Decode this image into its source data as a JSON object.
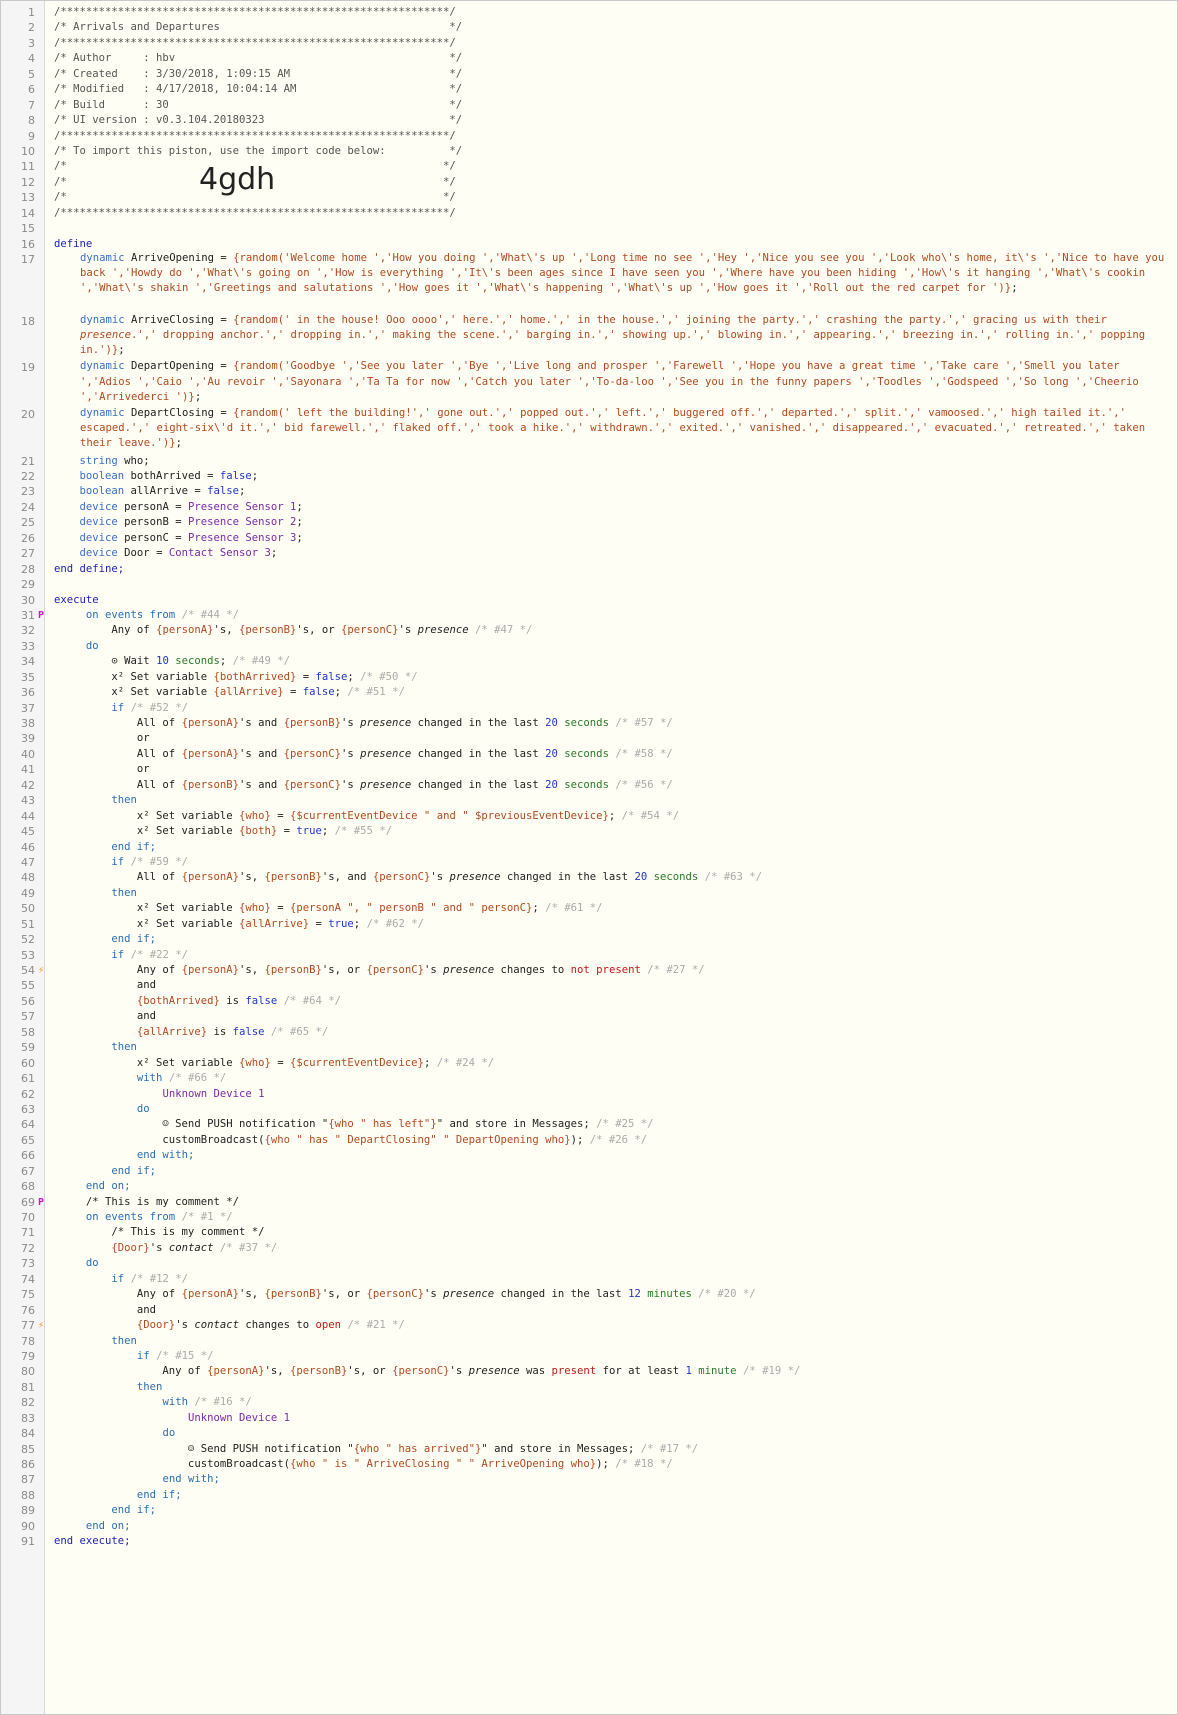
{
  "editor": {
    "big_code": "4gdh",
    "lines": [
      {
        "n": "1",
        "t": "/*************************************************************/"
      },
      {
        "n": "2",
        "t": "/* Arrivals and Departures                                    */"
      },
      {
        "n": "3",
        "t": "/*************************************************************/"
      },
      {
        "n": "4",
        "t": "/* Author     : hbv                                           */"
      },
      {
        "n": "5",
        "t": "/* Created    : 3/30/2018, 1:09:15 AM                         */"
      },
      {
        "n": "6",
        "t": "/* Modified   : 4/17/2018, 10:04:14 AM                        */"
      },
      {
        "n": "7",
        "t": "/* Build      : 30                                            */"
      },
      {
        "n": "8",
        "t": "/* UI version : v0.3.104.20180323                             */"
      },
      {
        "n": "9",
        "t": "/*************************************************************/"
      },
      {
        "n": "10",
        "t": "/* To import this piston, use the import code below:          */"
      },
      {
        "n": "11",
        "t": "/*                                                           */"
      },
      {
        "n": "12",
        "t": "/*                                                           */"
      },
      {
        "n": "13",
        "t": "/*                                                           */"
      },
      {
        "n": "14",
        "t": "/*************************************************************/"
      },
      {
        "n": "15",
        "t": ""
      },
      {
        "n": "16",
        "t": "define"
      },
      {
        "n": "17",
        "t": "    dynamic ArriveOpening = {random('Welcome home ','How you doing ','What\\'s up ','Long time no see ','Hey ','Nice you see you ','Look who\\'s home, it\\'s ','Nice to have you back ','Howdy do ','What\\'s going on ','How is everything ','It\\'s been ages since I have seen you ','Where have you been hiding ','How\\'s it hanging ','What\\'s cookin ','What\\'s shakin ','Greetings and salutations ','How goes it ','What\\'s happening ','What\\'s up ','How goes it ','Roll out the red carpet for ')};"
      },
      {
        "n": "18",
        "t": "    dynamic ArriveClosing = {random(' in the house! Ooo oooo',' here.',' home.',' in the house.',' joining the party.',' crashing the party.',' gracing us with their presence.',' dropping anchor.',' dropping in.',' making the scene.',' barging in.',' showing up.',' blowing in.',' appearing.',' breezing in.',' rolling in.',' popping in.')};"
      },
      {
        "n": "19",
        "t": "    dynamic DepartOpening = {random('Goodbye ','See you later ','Bye ','Live long and prosper ','Farewell ','Hope you have a great time ','Take care ','Smell you later ','Adios ','Caio ','Au revoir ','Sayonara ','Ta Ta for now ','Catch you later ','To-da-loo ','See you in the funny papers ','Toodles ','Godspeed ','So long ','Cheerio ','Arrivederci ')};"
      },
      {
        "n": "20",
        "t": "    dynamic DepartClosing = {random(' left the building!',' gone out.',' popped out.',' left.',' buggered off.',' departed.',' split.',' vamoosed.',' high tailed it.',' escaped.',' eight-six\\'d it.',' bid farewell.',' flaked off.',' took a hike.',' withdrawn.',' exited.',' vanished.',' disappeared.',' evacuated.',' retreated.',' taken their leave.')};"
      },
      {
        "n": "21",
        "t": "    string who;"
      },
      {
        "n": "22",
        "t": "    boolean bothArrived = false;"
      },
      {
        "n": "23",
        "t": "    boolean allArrive = false;"
      },
      {
        "n": "24",
        "t": "    device personA = Presence Sensor 1;"
      },
      {
        "n": "25",
        "t": "    device personB = Presence Sensor 2;"
      },
      {
        "n": "26",
        "t": "    device personC = Presence Sensor 3;"
      },
      {
        "n": "27",
        "t": "    device Door = Contact Sensor 3;"
      },
      {
        "n": "28",
        "t": "end define;"
      },
      {
        "n": "29",
        "t": ""
      },
      {
        "n": "30",
        "t": "execute"
      },
      {
        "n": "31",
        "t": "     on events from /* #44 */"
      },
      {
        "n": "32",
        "t": "         Any of {personA}'s, {personB}'s, or {personC}'s presence /* #47 */"
      },
      {
        "n": "33",
        "t": "     do"
      },
      {
        "n": "34",
        "t": "         ⊙ Wait 10 seconds; /* #49 */"
      },
      {
        "n": "35",
        "t": "         x² Set variable {bothArrived} = false; /* #50 */"
      },
      {
        "n": "36",
        "t": "         x² Set variable {allArrive} = false; /* #51 */"
      },
      {
        "n": "37",
        "t": "         if /* #52 */"
      },
      {
        "n": "38",
        "t": "             All of {personA}'s and {personB}'s presence changed in the last 20 seconds /* #57 */"
      },
      {
        "n": "39",
        "t": "             or"
      },
      {
        "n": "40",
        "t": "             All of {personA}'s and {personC}'s presence changed in the last 20 seconds /* #58 */"
      },
      {
        "n": "41",
        "t": "             or"
      },
      {
        "n": "42",
        "t": "             All of {personB}'s and {personC}'s presence changed in the last 20 seconds /* #56 */"
      },
      {
        "n": "43",
        "t": "         then"
      },
      {
        "n": "44",
        "t": "             x² Set variable {who} = {$currentEventDevice \" and \" $previousEventDevice}; /* #54 */"
      },
      {
        "n": "45",
        "t": "             x² Set variable {both} = true; /* #55 */"
      },
      {
        "n": "46",
        "t": "         end if;"
      },
      {
        "n": "47",
        "t": "         if /* #59 */"
      },
      {
        "n": "48",
        "t": "             All of {personA}'s, {personB}'s, and {personC}'s presence changed in the last 20 seconds /* #63 */"
      },
      {
        "n": "49",
        "t": "         then"
      },
      {
        "n": "50",
        "t": "             x² Set variable {who} = {personA \", \" personB \" and \" personC}; /* #61 */"
      },
      {
        "n": "51",
        "t": "             x² Set variable {allArrive} = true; /* #62 */"
      },
      {
        "n": "52",
        "t": "         end if;"
      },
      {
        "n": "53",
        "t": "         if /* #22 */"
      },
      {
        "n": "54",
        "t": "             Any of {personA}'s, {personB}'s, or {personC}'s presence changes to not present /* #27 */"
      },
      {
        "n": "55",
        "t": "             and"
      },
      {
        "n": "56",
        "t": "             {bothArrived} is false /* #64 */"
      },
      {
        "n": "57",
        "t": "             and"
      },
      {
        "n": "58",
        "t": "             {allArrive} is false /* #65 */"
      },
      {
        "n": "59",
        "t": "         then"
      },
      {
        "n": "60",
        "t": "             x² Set variable {who} = {$currentEventDevice}; /* #24 */"
      },
      {
        "n": "61",
        "t": "             with /* #66 */"
      },
      {
        "n": "62",
        "t": "                 Unknown Device 1"
      },
      {
        "n": "63",
        "t": "             do"
      },
      {
        "n": "64",
        "t": "                 ☺ Send PUSH notification \"{who \" has left\"}\" and store in Messages; /* #25 */"
      },
      {
        "n": "65",
        "t": "                 customBroadcast({who \" has \" DepartClosing\" \" DepartOpening who}); /* #26 */"
      },
      {
        "n": "66",
        "t": "             end with;"
      },
      {
        "n": "67",
        "t": "         end if;"
      },
      {
        "n": "68",
        "t": "     end on;"
      },
      {
        "n": "69",
        "t": "     /* This is my comment */"
      },
      {
        "n": "70",
        "t": "     on events from /* #1 */"
      },
      {
        "n": "71",
        "t": "         /* This is my comment */"
      },
      {
        "n": "72",
        "t": "         {Door}'s contact /* #37 */"
      },
      {
        "n": "73",
        "t": "     do"
      },
      {
        "n": "74",
        "t": "         if /* #12 */"
      },
      {
        "n": "75",
        "t": "             Any of {personA}'s, {personB}'s, or {personC}'s presence changed in the last 12 minutes /* #20 */"
      },
      {
        "n": "76",
        "t": "             and"
      },
      {
        "n": "77",
        "t": "             {Door}'s contact changes to open /* #21 */"
      },
      {
        "n": "78",
        "t": "         then"
      },
      {
        "n": "79",
        "t": "             if /* #15 */"
      },
      {
        "n": "80",
        "t": "                 Any of {personA}'s, {personB}'s, or {personC}'s presence was present for at least 1 minute /* #19 */"
      },
      {
        "n": "81",
        "t": "             then"
      },
      {
        "n": "82",
        "t": "                 with /* #16 */"
      },
      {
        "n": "83",
        "t": "                     Unknown Device 1"
      },
      {
        "n": "84",
        "t": "                 do"
      },
      {
        "n": "85",
        "t": "                     ☺ Send PUSH notification \"{who \" has arrived\"}\" and store in Messages; /* #17 */"
      },
      {
        "n": "86",
        "t": "                     customBroadcast({who \" is \" ArriveClosing \" \" ArriveOpening who}); /* #18 */"
      },
      {
        "n": "87",
        "t": "                 end with;"
      },
      {
        "n": "88",
        "t": "             end if;"
      },
      {
        "n": "89",
        "t": "         end if;"
      },
      {
        "n": "90",
        "t": "     end on;"
      },
      {
        "n": "91",
        "t": "end execute;"
      }
    ]
  }
}
